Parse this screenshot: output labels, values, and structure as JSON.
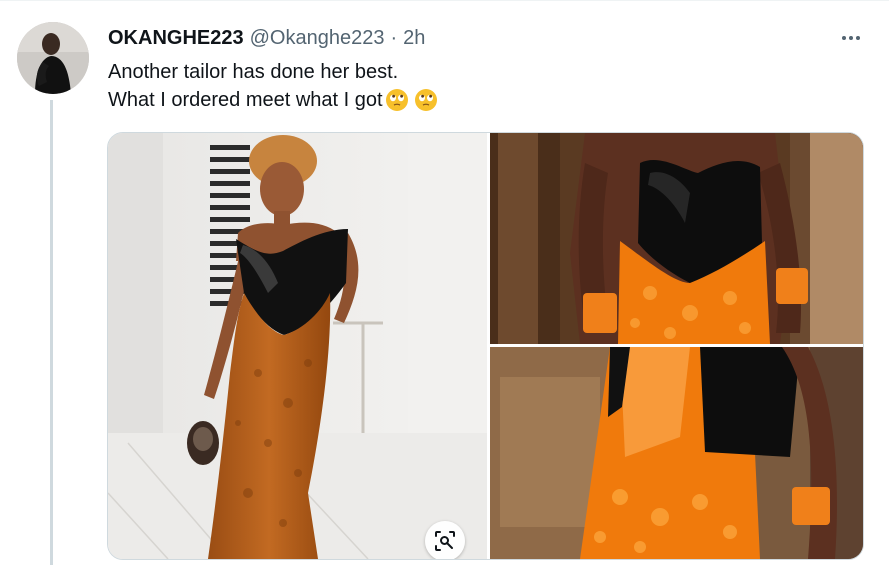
{
  "tweet": {
    "display_name": "OKANGHE223",
    "handle": "@Okanghe223",
    "separator": "·",
    "time": "2h",
    "text_line1": "Another tailor has done her best.",
    "text_line2": "What I ordered meet what I got",
    "emojis": [
      "face-with-rolling-eyes-emoji",
      "face-with-rolling-eyes-emoji"
    ]
  },
  "icons": {
    "more": "more-horizontal-icon",
    "scan": "visual-search-icon"
  },
  "colors": {
    "text_primary": "#0f1419",
    "text_secondary": "#536471",
    "border": "#cfd9de",
    "thread_line": "#cfd9de"
  }
}
